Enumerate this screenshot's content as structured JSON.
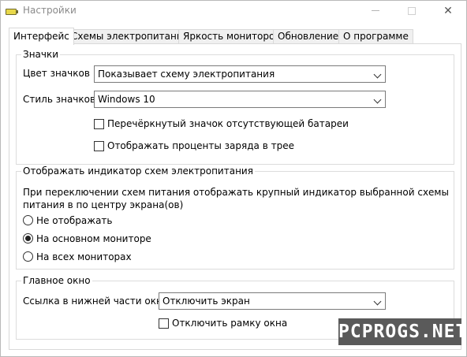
{
  "window": {
    "title": "Настройки"
  },
  "tabs": [
    {
      "label": "Интерфейс",
      "active": true
    },
    {
      "label": "Схемы электропитания",
      "active": false
    },
    {
      "label": "Яркость мониторов",
      "active": false
    },
    {
      "label": "Обновление",
      "active": false
    },
    {
      "label": "О программе",
      "active": false
    }
  ],
  "icons_group": {
    "title": "Значки",
    "icon_color": {
      "label": "Цвет значков",
      "value": "Показывает схему электропитания"
    },
    "icon_style": {
      "label": "Стиль значков",
      "value": "Windows 10"
    },
    "strike_missing_battery": {
      "label": "Перечёркнутый значок отсутствующей батареи",
      "checked": false
    },
    "show_percent_tray": {
      "label": "Отображать проценты заряда в трее",
      "checked": false
    }
  },
  "indicator_group": {
    "title": "Отображать индикатор схем электропитания",
    "description": "При переключении схем питания отображать крупный индикатор выбранной схемы питания в по центру экрана(ов)",
    "options": [
      {
        "label": "Не отображать",
        "checked": false
      },
      {
        "label": "На основном мониторе",
        "checked": true
      },
      {
        "label": "На всех мониторах",
        "checked": false
      }
    ]
  },
  "main_window_group": {
    "title": "Главное окно",
    "bottom_link": {
      "label": "Ссылка в нижней части окна",
      "value": "Отключить экран"
    },
    "disable_frame": {
      "label": "Отключить рамку окна",
      "checked": false
    }
  },
  "watermark": {
    "text": "PCPROGS.NET"
  }
}
